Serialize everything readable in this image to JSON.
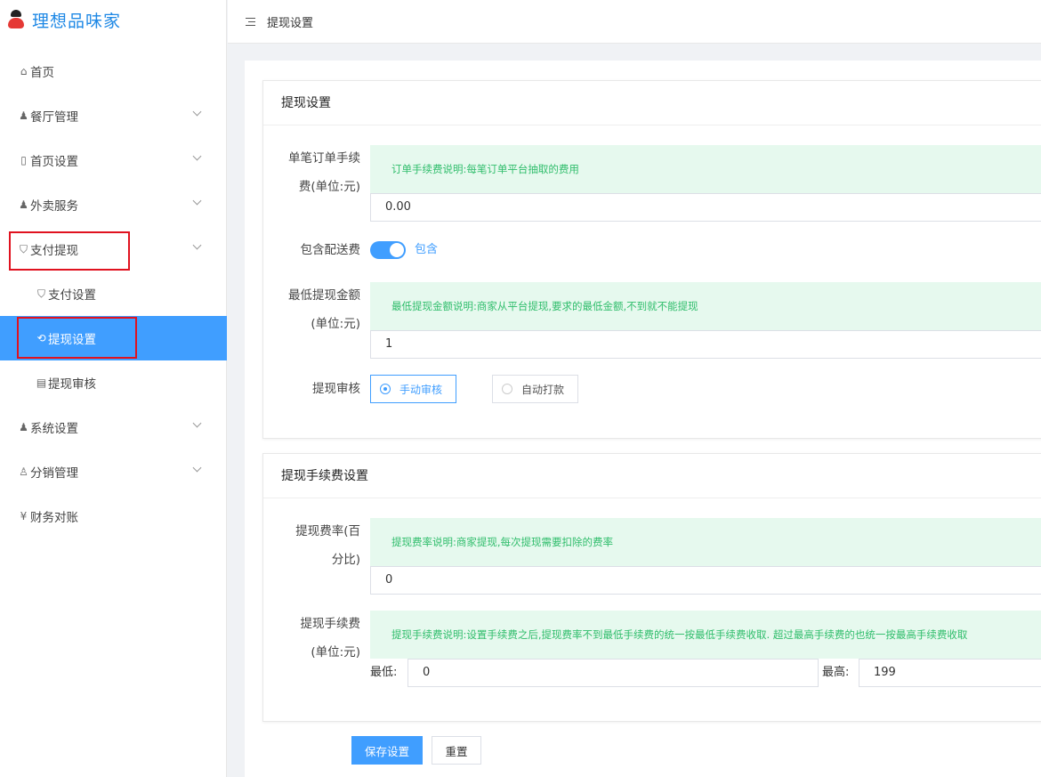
{
  "app": {
    "title": "理想品味家"
  },
  "header": {
    "breadcrumb": "提现设置"
  },
  "sidebar": {
    "items": [
      {
        "label": "首页",
        "icon": "home-icon"
      },
      {
        "label": "餐厅管理",
        "icon": "user-icon"
      },
      {
        "label": "首页设置",
        "icon": "phone-icon"
      },
      {
        "label": "外卖服务",
        "icon": "user-icon"
      },
      {
        "label": "支付提现",
        "icon": "shield-icon"
      },
      {
        "label": "支付设置",
        "icon": "shield-icon"
      },
      {
        "label": "提现设置",
        "icon": "sync-icon"
      },
      {
        "label": "提现审核",
        "icon": "doc-icon"
      },
      {
        "label": "系统设置",
        "icon": "user-icon"
      },
      {
        "label": "分销管理",
        "icon": "users-icon"
      },
      {
        "label": "财务对账",
        "icon": "ledger-icon"
      }
    ]
  },
  "withdraw_settings": {
    "title": "提现设置",
    "order_fee": {
      "label_line1": "单笔订单手续",
      "label_line2": "费(单位:元)",
      "tip": "订单手续费说明:每笔订单平台抽取的费用",
      "value": "0.00"
    },
    "delivery_fee": {
      "label": "包含配送费",
      "switch_text": "包含",
      "enabled": true
    },
    "min_withdraw": {
      "label_line1": "最低提现金额",
      "label_line2": "(单位:元)",
      "tip": "最低提现金额说明:商家从平台提现,要求的最低金额,不到就不能提现",
      "value": "1"
    },
    "review": {
      "label": "提现审核",
      "options": [
        "手动审核",
        "自动打款"
      ],
      "selected": "手动审核"
    }
  },
  "fee_settings": {
    "title": "提现手续费设置",
    "rate": {
      "label_line1": "提现费率(百",
      "label_line2": "分比)",
      "tip": "提现费率说明:商家提现,每次提现需要扣除的费率",
      "value": "0"
    },
    "fee": {
      "label_line1": "提现手续费",
      "label_line2": "(单位:元)",
      "tip": "提现手续费说明:设置手续费之后,提现费率不到最低手续费的统一按最低手续费收取. 超过最高手续费的也统一按最高手续费收取",
      "min_label": "最低:",
      "min_value": "0",
      "max_label": "最高:",
      "max_value": "199"
    }
  },
  "actions": {
    "save": "保存设置",
    "reset": "重置"
  },
  "colors": {
    "primary": "#409eff",
    "tip_bg": "#e6f9ee",
    "tip_text": "#2fbd6b",
    "highlight": "#e0121f"
  }
}
